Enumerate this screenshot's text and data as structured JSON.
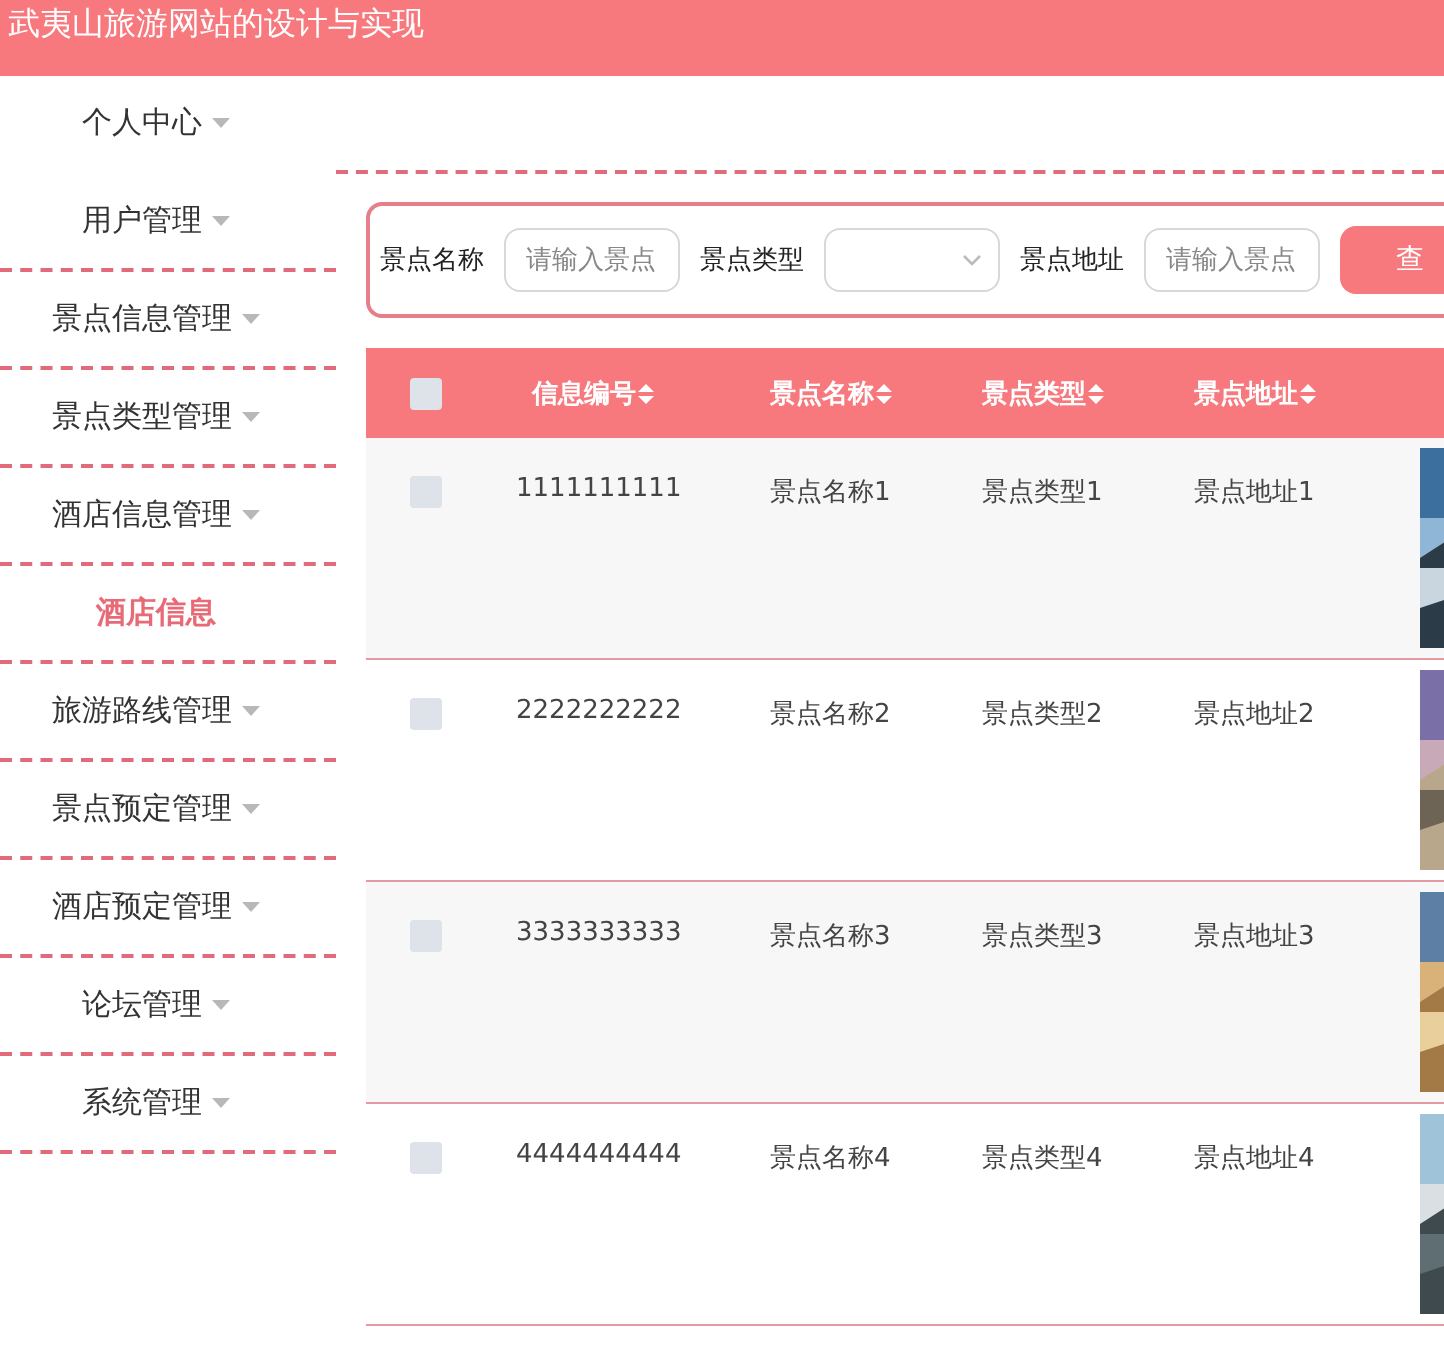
{
  "header": {
    "title": "武夷山旅游网站的设计与实现"
  },
  "sidebar": {
    "items": [
      {
        "label": "个人中心",
        "kind": "menu",
        "selected": false
      },
      {
        "label": "用户管理",
        "kind": "menu",
        "selected": false
      },
      {
        "label": "景点信息管理",
        "kind": "menu",
        "selected": false
      },
      {
        "label": "景点类型管理",
        "kind": "menu",
        "selected": false
      },
      {
        "label": "酒店信息管理",
        "kind": "menu",
        "selected": false
      },
      {
        "label": "酒店信息",
        "kind": "sub",
        "selected": true
      },
      {
        "label": "旅游路线管理",
        "kind": "menu",
        "selected": false
      },
      {
        "label": "景点预定管理",
        "kind": "menu",
        "selected": false
      },
      {
        "label": "酒店预定管理",
        "kind": "menu",
        "selected": false
      },
      {
        "label": "论坛管理",
        "kind": "menu",
        "selected": false
      },
      {
        "label": "系统管理",
        "kind": "menu",
        "selected": false
      }
    ]
  },
  "search": {
    "fields": [
      {
        "label": "景点名称",
        "kind": "input",
        "placeholder": "请输入景点"
      },
      {
        "label": "景点类型",
        "kind": "select"
      },
      {
        "label": "景点地址",
        "kind": "input",
        "placeholder": "请输入景点"
      }
    ],
    "button": "查"
  },
  "table": {
    "header_checked": false,
    "columns": [
      "信息编号",
      "景点名称",
      "景点类型",
      "景点地址"
    ],
    "rows": [
      {
        "selected": false,
        "cells": [
          "1111111111",
          "景点名称1",
          "景点类型1",
          "景点地址1"
        ]
      },
      {
        "selected": false,
        "cells": [
          "2222222222",
          "景点名称2",
          "景点类型2",
          "景点地址2"
        ]
      },
      {
        "selected": false,
        "cells": [
          "3333333333",
          "景点名称3",
          "景点类型3",
          "景点地址3"
        ]
      },
      {
        "selected": false,
        "cells": [
          "4444444444",
          "景点名称4",
          "景点类型4",
          "景点地址4"
        ]
      }
    ]
  }
}
